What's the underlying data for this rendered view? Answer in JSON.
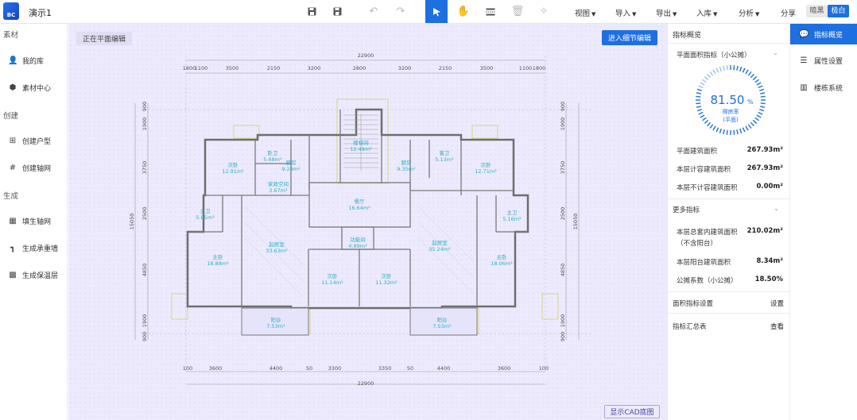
{
  "app": {
    "logo_text": "BC",
    "doc_title": "演示1"
  },
  "toolbar": {
    "icons": [
      "save-icon",
      "save-as-icon",
      "undo-icon",
      "redo-icon",
      "select-pointer-icon",
      "pan-hand-icon",
      "wall-split-icon",
      "delete-icon",
      "magic-icon"
    ],
    "menus": [
      {
        "label": "视图"
      },
      {
        "label": "导入"
      },
      {
        "label": "导出"
      },
      {
        "label": "入库"
      },
      {
        "label": "分析"
      }
    ],
    "share_label": "分享",
    "theme": {
      "dark_label": "暗黑",
      "light_label": "极白",
      "selected": "极白"
    },
    "accent_color": "#1e6fe0"
  },
  "left_sidebar": {
    "sections": [
      {
        "title": "素材",
        "items": [
          {
            "label": "我的库",
            "icon": "user-icon"
          },
          {
            "label": "素材中心",
            "icon": "cube-icon"
          }
        ]
      },
      {
        "title": "创建",
        "items": [
          {
            "label": "创建户型",
            "icon": "plus-square-icon"
          },
          {
            "label": "创建轴网",
            "icon": "grid-icon"
          }
        ]
      },
      {
        "title": "生成",
        "items": [
          {
            "label": "填生轴网",
            "icon": "table-icon"
          },
          {
            "label": "生成承重墙",
            "icon": "wall-corner-icon"
          },
          {
            "label": "生成保温层",
            "icon": "insulation-icon"
          }
        ]
      }
    ]
  },
  "canvas": {
    "mode_label": "正在平面编辑",
    "enter_detail_button": "进入细节编辑",
    "show_cad_button": "显示CAD底图",
    "plan": {
      "top_total": "22900",
      "top_dims": [
        "1800",
        "1100",
        "3500",
        "2150",
        "3200",
        "2800",
        "3200",
        "2150",
        "3500",
        "1100",
        "1800"
      ],
      "bottom_total": "22900",
      "bottom_dims": [
        "100",
        "3600",
        "4400",
        "50",
        "3300",
        "3350",
        "50",
        "4400",
        "3600",
        "100"
      ],
      "left_total": "15050",
      "left_dims": [
        "900",
        "1900",
        "3750",
        "2500",
        "4850",
        "1900",
        "900"
      ],
      "right_total": "15050",
      "right_dims": [
        "900",
        "1900",
        "3750",
        "2500",
        "4850",
        "1900",
        "900"
      ],
      "rooms": [
        {
          "name": "楼梯间",
          "area": "12.49m²"
        },
        {
          "name": "卧卫",
          "area": "5.68m²"
        },
        {
          "name": "厨房",
          "area": "9.24m²"
        },
        {
          "name": "次卧",
          "area": "12.91m²"
        },
        {
          "name": "厨房",
          "area": "9.35m²"
        },
        {
          "name": "客卫",
          "area": "5.13m²"
        },
        {
          "name": "次卧",
          "area": "12.71m²"
        },
        {
          "name": "家政空间",
          "area": "3.67m²"
        },
        {
          "name": "餐厅",
          "area": "16.64m²"
        },
        {
          "name": "主卫",
          "area": "5.85m²"
        },
        {
          "name": "主卫",
          "area": "5.16m²"
        },
        {
          "name": "起居室",
          "area": "33.63m²"
        },
        {
          "name": "起居室",
          "area": "35.24m²"
        },
        {
          "name": "功能间",
          "area": "4.89m²"
        },
        {
          "name": "主卧",
          "area": "18.88m²"
        },
        {
          "name": "主卧",
          "area": "18.06m²"
        },
        {
          "name": "次卧",
          "area": "11.14m²"
        },
        {
          "name": "次卧",
          "area": "11.32m²"
        },
        {
          "name": "阳台",
          "area": "7.53m²"
        },
        {
          "name": "阳台",
          "area": "7.53m²"
        }
      ]
    }
  },
  "right_panel": {
    "title": "指标概览",
    "section_title": "平面面积指标（小公摊）",
    "gauge": {
      "value_number": "81.50",
      "value_unit": "%",
      "label1": "得房率",
      "label2": "(平面)",
      "fraction": 0.815
    },
    "stats": [
      {
        "label": "平面建筑面积",
        "value": "267.93m²"
      },
      {
        "label": "本层计容建筑面积",
        "value": "267.93m²"
      },
      {
        "label": "本层不计容建筑面积",
        "value": "0.00m²"
      }
    ],
    "more_title": "更多指标",
    "more_stats": [
      {
        "label": "本层总套内建筑面积",
        "label2": "（不含阳台）",
        "value": "210.02m²"
      },
      {
        "label": "本层阳台建筑面积",
        "value": "8.34m²"
      },
      {
        "label": "公摊系数（小公摊）",
        "value": "18.50%"
      }
    ],
    "area_setting_label": "面积指标设置",
    "area_setting_link": "设置",
    "summary_label": "指标汇总表",
    "summary_link": "查看"
  },
  "right_tabs": [
    {
      "label": "指标概览",
      "icon": "chat-icon",
      "active": true
    },
    {
      "label": "属性设置",
      "icon": "list-icon",
      "active": false
    },
    {
      "label": "楼栋系统",
      "icon": "building-icon",
      "active": false
    }
  ]
}
